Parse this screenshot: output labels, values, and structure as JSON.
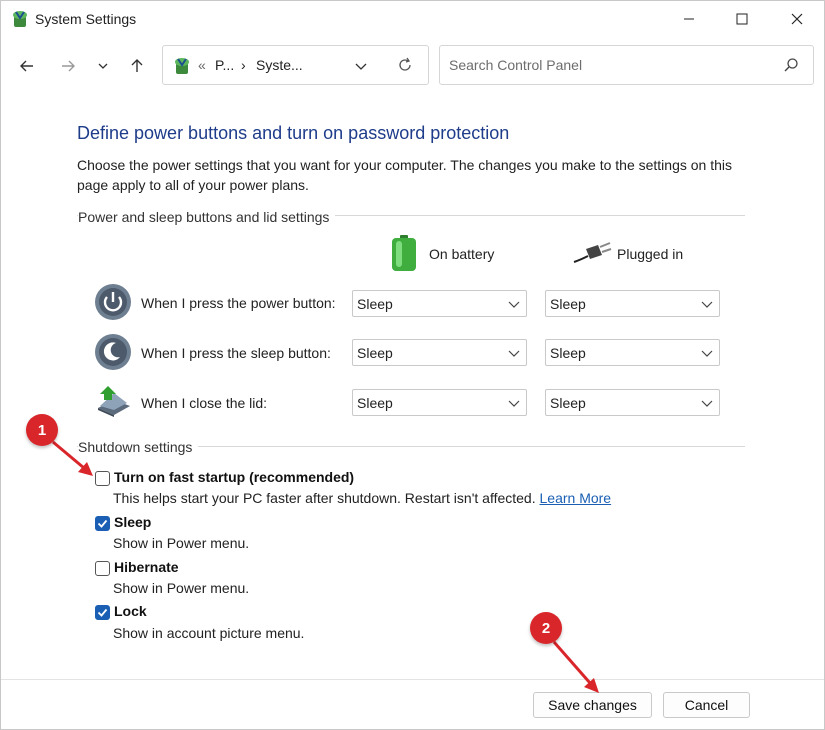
{
  "window": {
    "title": "System Settings",
    "minimize_glyph": "—",
    "maximize_glyph": "☐",
    "close_glyph": "✕"
  },
  "address": {
    "crumb_sep": "«",
    "crumb1": "P...",
    "crumb_arrow": "›",
    "crumb2": "Syste..."
  },
  "search": {
    "placeholder": "Search Control Panel"
  },
  "page": {
    "heading": "Define power buttons and turn on password protection",
    "description": "Choose the power settings that you want for your computer. The changes you make to the settings on this page apply to all of your power plans."
  },
  "power_group": {
    "label": "Power and sleep buttons and lid settings",
    "col_battery": "On battery",
    "col_plugged": "Plugged in",
    "rows": [
      {
        "label": "When I press the power button:",
        "battery": "Sleep",
        "plugged": "Sleep",
        "icon": "power-button-icon"
      },
      {
        "label": "When I press the sleep button:",
        "battery": "Sleep",
        "plugged": "Sleep",
        "icon": "sleep-button-icon"
      },
      {
        "label": "When I close the lid:",
        "battery": "Sleep",
        "plugged": "Sleep",
        "icon": "laptop-lid-icon"
      }
    ]
  },
  "shutdown_group": {
    "label": "Shutdown settings",
    "options": [
      {
        "title": "Turn on fast startup (recommended)",
        "subtitle": "This helps start your PC faster after shutdown. Restart isn't affected.",
        "link": "Learn More",
        "checked": false
      },
      {
        "title": "Sleep",
        "subtitle": "Show in Power menu.",
        "checked": true
      },
      {
        "title": "Hibernate",
        "subtitle": "Show in Power menu.",
        "checked": false
      },
      {
        "title": "Lock",
        "subtitle": "Show in account picture menu.",
        "checked": true
      }
    ]
  },
  "footer": {
    "save_label": "Save changes",
    "cancel_label": "Cancel"
  },
  "callouts": {
    "one": "1",
    "two": "2"
  },
  "colors": {
    "accent": "#1a5fb4",
    "heading": "#1e3c8a",
    "callout": "#d9262b"
  }
}
